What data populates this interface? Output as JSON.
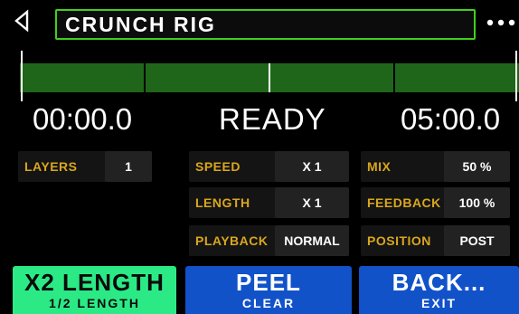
{
  "header": {
    "title": "CRUNCH RIG",
    "back_icon": "left-arrow-icon",
    "more_icon": "more-dots-icon"
  },
  "timeline": {
    "segments": 4,
    "playhead_fraction": 0.5
  },
  "time": {
    "start": "00:00.0",
    "status": "READY",
    "end": "05:00.0"
  },
  "params": [
    {
      "label": "LAYERS",
      "value": "1"
    },
    {
      "label": "SPEED",
      "value": "X 1"
    },
    {
      "label": "MIX",
      "value": "50 %"
    },
    {
      "label": "LENGTH",
      "value": "X 1"
    },
    {
      "label": "FEEDBACK",
      "value": "100 %"
    },
    {
      "label": "PLAYBACK",
      "value": "NORMAL"
    },
    {
      "label": "POSITION",
      "value": "POST"
    }
  ],
  "buttons": {
    "left": {
      "main": "X2 LENGTH",
      "sub": "1/2 LENGTH"
    },
    "center": {
      "main": "PEEL",
      "sub": "CLEAR"
    },
    "right": {
      "main": "BACK...",
      "sub": "EXIT"
    }
  },
  "colors": {
    "accent_green": "#3fd11c",
    "track_green": "#1f661a",
    "label_gold": "#d9a61e",
    "button_green": "#2bea86",
    "button_blue": "#1252c9"
  }
}
